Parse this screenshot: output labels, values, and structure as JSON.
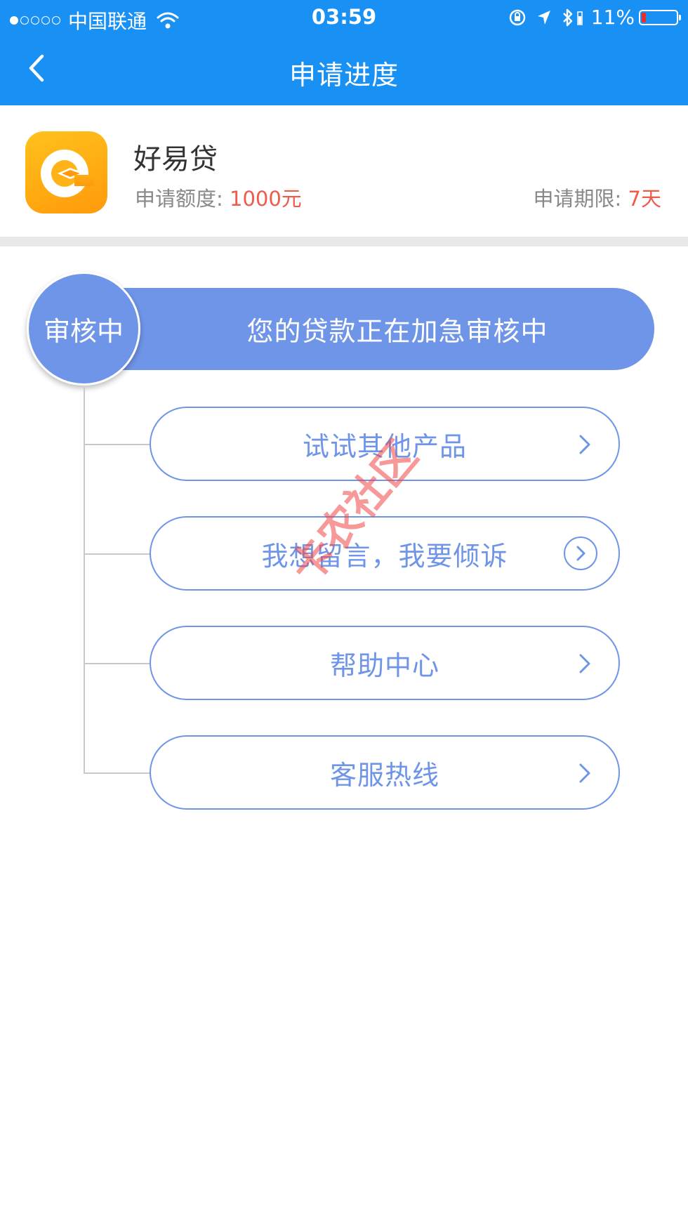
{
  "status_bar": {
    "carrier": "中国联通",
    "time": "03:59",
    "battery_percent": "11%",
    "icons": [
      "signal-dots-icon",
      "wifi-icon",
      "rotation-lock-icon",
      "location-icon",
      "bluetooth-icon",
      "battery-icon"
    ]
  },
  "nav": {
    "title": "申请进度",
    "back_icon": "chevron-left-icon"
  },
  "product": {
    "name": "好易贷",
    "amount_label": "申请额度:",
    "amount_value": "1000元",
    "term_label": "申请期限:",
    "term_value": "7天",
    "logo_icon": "haoyidai-logo-icon"
  },
  "progress": {
    "status_label": "审核中",
    "status_message": "您的贷款正在加急审核中"
  },
  "actions": [
    {
      "label": "试试其他产品",
      "icon": "chevron-right-icon"
    },
    {
      "label": "我想留言，我要倾诉",
      "icon": "chevron-right-circle-icon"
    },
    {
      "label": "帮助中心",
      "icon": "chevron-right-icon"
    },
    {
      "label": "客服热线",
      "icon": "chevron-right-icon"
    }
  ],
  "watermark": "卡农社区",
  "colors": {
    "header_blue": "#1990f4",
    "accent_blue": "#6f95e8",
    "highlight_red": "#f05a4a",
    "battery_red": "#e8302b"
  }
}
